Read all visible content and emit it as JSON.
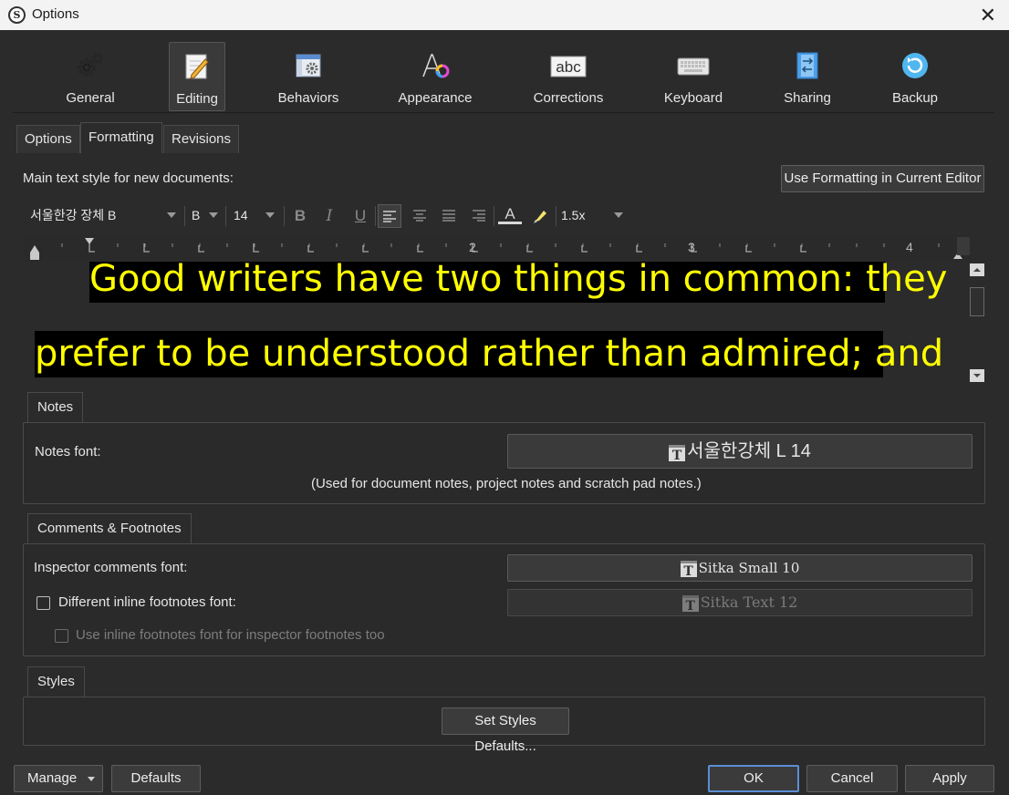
{
  "window": {
    "title": "Options",
    "app_icon_letter": "S",
    "close_glyph": "✕"
  },
  "toolbar": {
    "items": [
      {
        "label": "General",
        "icon": "gears-icon"
      },
      {
        "label": "Editing",
        "icon": "notepad-pencil-icon",
        "selected": true
      },
      {
        "label": "Behaviors",
        "icon": "window-gear-icon"
      },
      {
        "label": "Appearance",
        "icon": "font-color-icon"
      },
      {
        "label": "Corrections",
        "icon": "abc-icon"
      },
      {
        "label": "Keyboard",
        "icon": "keyboard-icon"
      },
      {
        "label": "Sharing",
        "icon": "sync-document-icon"
      },
      {
        "label": "Backup",
        "icon": "backup-refresh-icon"
      }
    ]
  },
  "tabs": [
    {
      "label": "Options"
    },
    {
      "label": "Formatting",
      "active": true
    },
    {
      "label": "Revisions"
    }
  ],
  "formatting": {
    "main_label": "Main text style for new documents:",
    "use_current_button": "Use Formatting in Current Editor",
    "font_family": "서울한강 장체 B",
    "font_weight": "B",
    "font_size": "14",
    "bold_glyph": "B",
    "italic_glyph": "I",
    "underline_glyph": "U",
    "text_color_glyph": "A",
    "line_spacing": "1.5x",
    "ruler_numbers": [
      "2",
      "3",
      "4"
    ],
    "sample_line1": "Good writers have two things in common: they",
    "sample_line2": "prefer to be understood rather than admired; and"
  },
  "notes": {
    "tab": "Notes",
    "label": "Notes font:",
    "font_value": "서울한강체 L 14",
    "hint": "(Used for document notes, project notes and scratch pad notes.)"
  },
  "comments": {
    "tab": "Comments & Footnotes",
    "inspector_label": "Inspector comments font:",
    "inspector_value": "Sitka Small 10",
    "inline_label": "Different inline footnotes font:",
    "inline_value": "Sitka Text 12",
    "inspector_too_label": "Use inline footnotes font for inspector footnotes too"
  },
  "styles": {
    "tab": "Styles",
    "button": "Set Styles Defaults..."
  },
  "footer": {
    "manage": "Manage",
    "defaults": "Defaults",
    "ok": "OK",
    "cancel": "Cancel",
    "apply": "Apply"
  },
  "colors": {
    "background": "#2b2b2b",
    "sample_text": "#ffff00",
    "sample_highlight": "#000000",
    "ok_border": "#5b8fd6"
  }
}
